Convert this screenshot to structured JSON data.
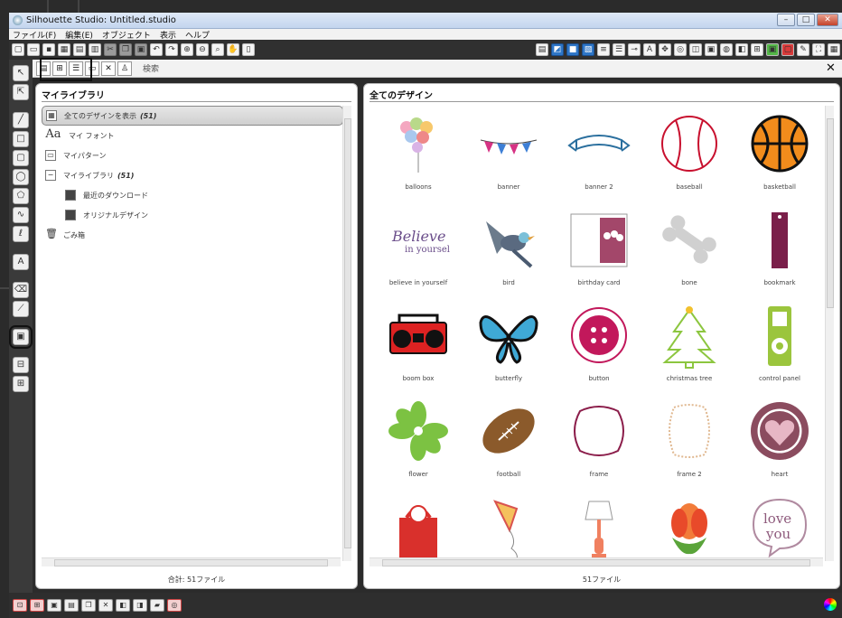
{
  "window": {
    "title": "Silhouette Studio: Untitled.studio",
    "controls": [
      "–",
      "□",
      "✕"
    ]
  },
  "menu": [
    "ファイル(F)",
    "編集(E)",
    "オブジェクト",
    "表示",
    "ヘルプ"
  ],
  "search": {
    "placeholder": "検索",
    "clear": "✕"
  },
  "library": {
    "heading": "マイライブラリ",
    "items": [
      {
        "label": "全てのデザインを表示",
        "count": "(51)"
      },
      {
        "label": "マイ フォント"
      },
      {
        "label": "マイパターン"
      },
      {
        "label": "マイライブラリ",
        "count": "(51)"
      },
      {
        "label": "最近のダウンロード"
      },
      {
        "label": "オリジナルデザイン"
      },
      {
        "label": "ごみ箱"
      }
    ],
    "footer": "合計: 51ファイル"
  },
  "designs": {
    "heading": "全てのデザイン",
    "items": [
      {
        "name": "balloons",
        "icon": "balloons"
      },
      {
        "name": "banner",
        "icon": "banner"
      },
      {
        "name": "banner 2",
        "icon": "banner2"
      },
      {
        "name": "baseball",
        "icon": "baseball"
      },
      {
        "name": "basketball",
        "icon": "basketball"
      },
      {
        "name": "believe in yourself",
        "icon": "text"
      },
      {
        "name": "bird",
        "icon": "bird"
      },
      {
        "name": "birthday card",
        "icon": "card"
      },
      {
        "name": "bone",
        "icon": "bone"
      },
      {
        "name": "bookmark",
        "icon": "bookmark"
      },
      {
        "name": "boom box",
        "icon": "boombox"
      },
      {
        "name": "butterfly",
        "icon": "butterfly"
      },
      {
        "name": "button",
        "icon": "button"
      },
      {
        "name": "christmas tree",
        "icon": "tree"
      },
      {
        "name": "control panel",
        "icon": "panel"
      },
      {
        "name": "flower",
        "icon": "flower"
      },
      {
        "name": "football",
        "icon": "football"
      },
      {
        "name": "frame",
        "icon": "frame"
      },
      {
        "name": "frame 2",
        "icon": "frame2"
      },
      {
        "name": "heart",
        "icon": "heart"
      },
      {
        "name": "",
        "icon": "bag"
      },
      {
        "name": "",
        "icon": "kite"
      },
      {
        "name": "",
        "icon": "lamp"
      },
      {
        "name": "",
        "icon": "lotus"
      },
      {
        "name": "",
        "icon": "love"
      }
    ],
    "believe_text": {
      "line1": "Believe",
      "line2": "in yourself"
    },
    "love_text": {
      "line1": "love",
      "line2": "you"
    },
    "footer": "51ファイル"
  }
}
